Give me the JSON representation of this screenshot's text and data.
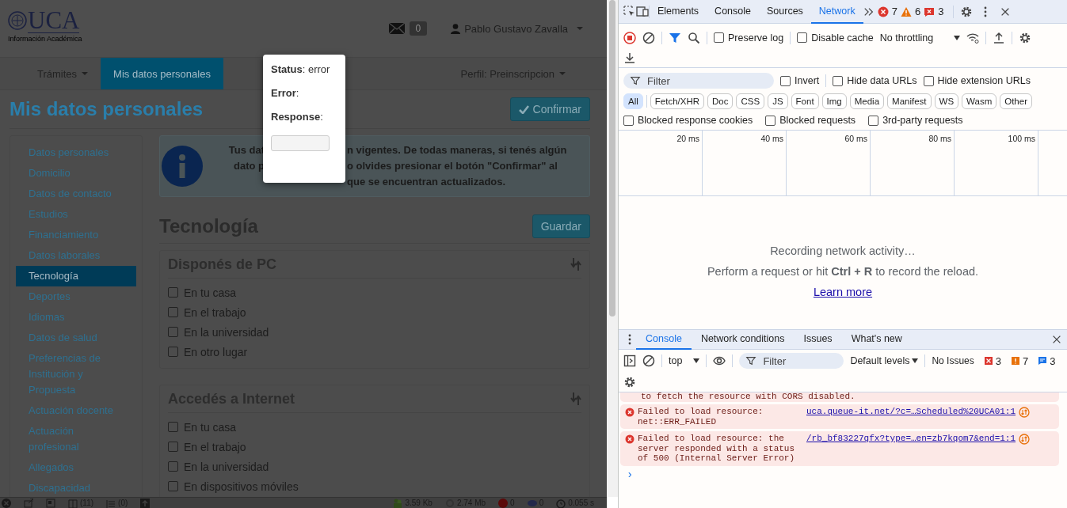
{
  "page": {
    "header": {
      "logo": "UCA",
      "logo_subtitle": "Información Académica",
      "message_count": "0",
      "user_name": "Pablo Gustavo Zavalla"
    },
    "nav": {
      "items": [
        {
          "label": "Trámites",
          "dropdown": true,
          "selected": false
        },
        {
          "label": "Mis datos personales",
          "dropdown": false,
          "selected": true
        }
      ],
      "profile": "Perfil: Preinscripcion"
    },
    "title": "Mis datos personales",
    "confirm_button": "Confirmar",
    "sidebar": {
      "items": [
        {
          "label": "Datos personales",
          "selected": false
        },
        {
          "label": "Domicilio",
          "selected": false
        },
        {
          "label": "Datos de contacto",
          "selected": false
        },
        {
          "label": "Estudios",
          "selected": false
        },
        {
          "label": "Financiamiento",
          "selected": false
        },
        {
          "label": "Datos laborales",
          "selected": false
        },
        {
          "label": "Tecnología",
          "selected": true
        },
        {
          "label": "Deportes",
          "selected": false
        },
        {
          "label": "Idiomas",
          "selected": false
        },
        {
          "label": "Datos de salud",
          "selected": false
        },
        {
          "label": "Preferencias de Institución y Propuesta",
          "selected": false
        },
        {
          "label": "Actuación docente",
          "selected": false
        },
        {
          "label": "Actuación profesional",
          "selected": false
        },
        {
          "label": "Allegados",
          "selected": false
        },
        {
          "label": "Discapacidad",
          "selected": false
        }
      ]
    },
    "alert": {
      "lines": [
        {
          "left": "Tus dat",
          "right": "n vigentes. De todas maneras, si tenés algún"
        },
        {
          "left": "dato p",
          "right": "o olvides presionar el botón \"Confirmar\" al"
        },
        {
          "right": "que se encuentran actualizados."
        }
      ]
    },
    "section": {
      "title": "Tecnología",
      "save_button": "Guardar",
      "panels": [
        {
          "title": "Disponés de PC",
          "options": [
            {
              "label": "En tu casa",
              "checked": false
            },
            {
              "label": "En el trabajo",
              "checked": false
            },
            {
              "label": "En la universidad",
              "checked": false
            },
            {
              "label": "En otro lugar",
              "checked": false
            }
          ]
        },
        {
          "title": "Accedés a Internet",
          "options": [
            {
              "label": "En tu casa",
              "checked": false
            },
            {
              "label": "En el trabajo",
              "checked": false
            },
            {
              "label": "En la universidad",
              "checked": false
            },
            {
              "label": "En dispositivos móviles",
              "checked": false
            }
          ]
        }
      ]
    },
    "modal": {
      "rows": [
        "**Status**: error",
        "**Error**:",
        "**Response**:"
      ]
    },
    "status_bar": {
      "items": [
        {
          "kind": "close"
        },
        {
          "kind": "popout"
        },
        {
          "kind": "window"
        },
        {
          "kind": "book",
          "text": "(11)"
        },
        {
          "kind": "list",
          "text": "(0)"
        },
        {
          "kind": "upload"
        },
        {
          "kind": "spacer"
        },
        {
          "kind": "people",
          "text": "3.59 Kb"
        },
        {
          "kind": "memory",
          "text": "2.74 Mb"
        },
        {
          "kind": "error",
          "text": "0"
        },
        {
          "kind": "php",
          "text": "0"
        },
        {
          "kind": "clock",
          "text": "0.055 s"
        }
      ]
    }
  },
  "devtools": {
    "tabs": [
      {
        "label": "Elements",
        "selected": false
      },
      {
        "label": "Console",
        "selected": false
      },
      {
        "label": "Sources",
        "selected": false
      },
      {
        "label": "Network",
        "selected": true
      }
    ],
    "error_count": "7",
    "warning_count": "6",
    "issue_count": "3",
    "network": {
      "preserve_log": {
        "label": "Preserve log",
        "checked": false
      },
      "disable_cache": {
        "label": "Disable cache",
        "checked": false
      },
      "throttling": "No throttling",
      "filter_placeholder": "Filter",
      "options": [
        {
          "label": "Invert",
          "checked": false
        },
        {
          "label": "Hide data URLs",
          "checked": false
        },
        {
          "label": "Hide extension URLs",
          "checked": false
        }
      ],
      "type_filters": [
        {
          "label": "All",
          "selected": true
        },
        {
          "label": "Fetch/XHR",
          "selected": false
        },
        {
          "label": "Doc",
          "selected": false
        },
        {
          "label": "CSS",
          "selected": false
        },
        {
          "label": "JS",
          "selected": false
        },
        {
          "label": "Font",
          "selected": false
        },
        {
          "label": "Img",
          "selected": false
        },
        {
          "label": "Media",
          "selected": false
        },
        {
          "label": "Manifest",
          "selected": false
        },
        {
          "label": "WS",
          "selected": false
        },
        {
          "label": "Wasm",
          "selected": false
        },
        {
          "label": "Other",
          "selected": false
        }
      ],
      "blocked_options": [
        {
          "label": "Blocked response cookies",
          "checked": false
        },
        {
          "label": "Blocked requests",
          "checked": false
        },
        {
          "label": "3rd-party requests",
          "checked": false
        }
      ],
      "timeline_ticks": [
        "20 ms",
        "40 ms",
        "60 ms",
        "80 ms",
        "100 ms"
      ],
      "empty_title": "Recording network activity…",
      "empty_hint": "Perform a request or hit **Ctrl + R** to record the reload.",
      "learn_more": "Learn more"
    },
    "drawer": {
      "tabs": [
        {
          "label": "Console",
          "selected": true
        },
        {
          "label": "Network conditions",
          "selected": false
        },
        {
          "label": "Issues",
          "selected": false
        },
        {
          "label": "What's new",
          "selected": false
        }
      ],
      "context": "top",
      "filter_placeholder": "Filter",
      "levels": "Default levels",
      "issues_label": "No Issues",
      "error_count": "3",
      "warning_count": "7",
      "info_count": "3",
      "messages": [
        {
          "kind": "continuation",
          "text": "to fetch the resource with CORS disabled."
        },
        {
          "kind": "error",
          "text": "Failed to load resource: net::ERR_FAILED",
          "source": "uca.queue-it.net/?c=…Scheduled%20UCA01:1"
        },
        {
          "kind": "error",
          "text": "Failed to load resource: the server responded with a status of 500 (Internal Server Error)",
          "source": "/rb_bf83227qfx?type=…en=zb7kqom7&end=1:1"
        }
      ],
      "prompt": "›"
    }
  }
}
